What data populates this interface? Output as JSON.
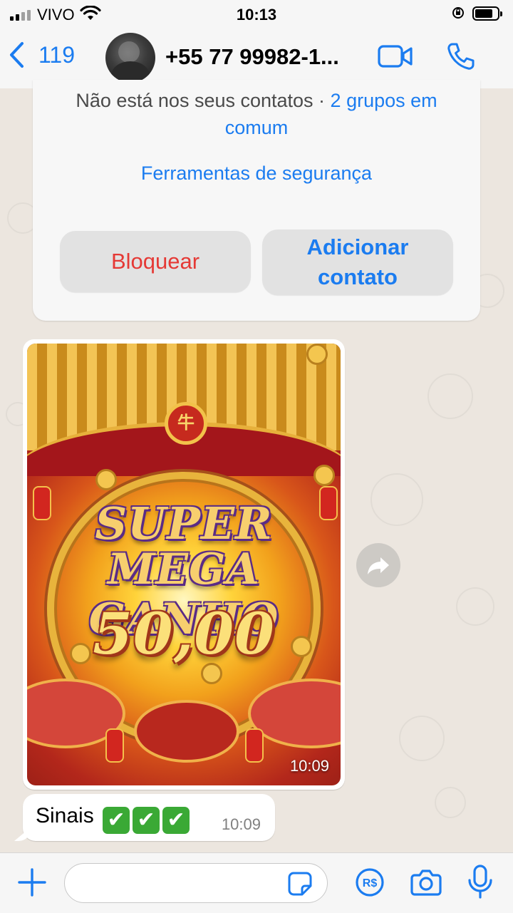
{
  "status_bar": {
    "carrier": "VIVO",
    "time": "10:13"
  },
  "header": {
    "back_count": "119",
    "contact_name": "+55 77 99982-1..."
  },
  "info_card": {
    "not_in_contacts": "Não está nos seus contatos",
    "separator": " · ",
    "groups_link": "2 grupos em comum",
    "safety_tools": "Ferramentas de segurança",
    "block_label": "Bloquear",
    "add_contact_label": "Adicionar contato"
  },
  "messages": [
    {
      "type": "media",
      "game_line1": "SUPER",
      "game_line2": "MEGA GANHO",
      "game_amount": "50,00",
      "time": "10:09"
    },
    {
      "type": "text",
      "text": "Sinais",
      "emoji": [
        "✔",
        "✔",
        "✔"
      ],
      "time": "10:09"
    }
  ],
  "input_bar": {
    "placeholder": ""
  },
  "colors": {
    "accent": "#1b7cf0",
    "danger": "#e53935",
    "check_emoji": "#3aa935"
  }
}
